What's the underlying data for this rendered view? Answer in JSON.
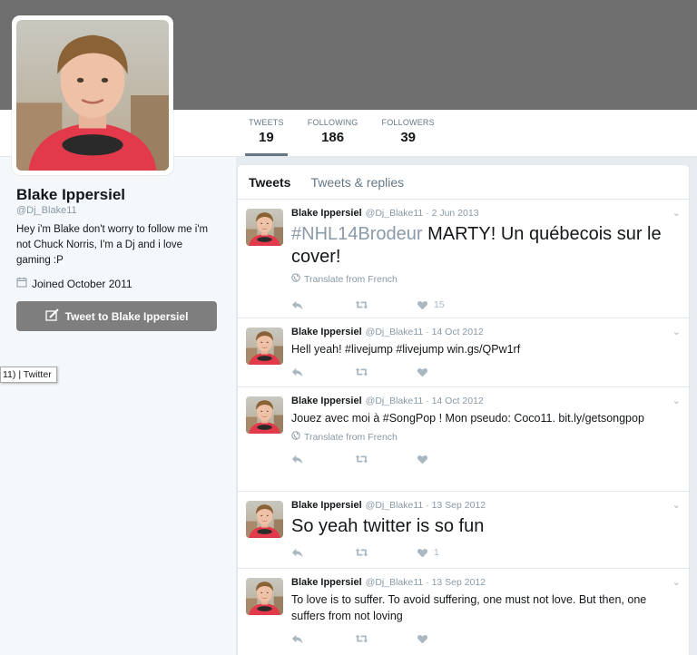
{
  "tooltip": "11) | Twitter",
  "profile": {
    "name": "Blake Ippersiel",
    "handle": "@Dj_Blake11",
    "bio": "Hey i'm Blake don't worry to follow me i'm not Chuck Norris, I'm a Dj and i love gaming :P",
    "joined": "Joined October 2011",
    "tweet_to_label": "Tweet to Blake Ippersiel"
  },
  "stats": [
    {
      "label": "TWEETS",
      "value": "19"
    },
    {
      "label": "FOLLOWING",
      "value": "186"
    },
    {
      "label": "FOLLOWERS",
      "value": "39"
    }
  ],
  "tabs": {
    "tweets": "Tweets",
    "replies": "Tweets & replies"
  },
  "tweets": [
    {
      "name": "Blake Ippersiel",
      "meta": "@Dj_Blake11 · 2 Jun 2013",
      "hashtag": "#NHL14Brodeur",
      "text": " MARTY! Un québecois sur le cover!",
      "translate": "Translate from French",
      "likes": "15"
    },
    {
      "name": "Blake Ippersiel",
      "meta": "@Dj_Blake11 · 14 Oct 2012",
      "text": "Hell yeah! #livejump #livejump win.gs/QPw1rf",
      "likes": ""
    },
    {
      "name": "Blake Ippersiel",
      "meta": "@Dj_Blake11 · 14 Oct 2012",
      "text": "Jouez avec moi à #SongPop ! Mon pseudo: Coco11. bit.ly/getsongpop",
      "translate": "Translate from French",
      "likes": ""
    },
    {
      "name": "Blake Ippersiel",
      "meta": "@Dj_Blake11 · 13 Sep 2012",
      "text": "So yeah twitter is so fun",
      "likes": "1"
    },
    {
      "name": "Blake Ippersiel",
      "meta": "@Dj_Blake11 · 13 Sep 2012",
      "text": "To love is to suffer. To avoid suffering, one must not love. But then, one suffers from not loving",
      "likes": ""
    }
  ],
  "colors": {
    "banner": "#6e6e6e",
    "button": "#7e7e7e",
    "background": "#e6ecf0"
  }
}
